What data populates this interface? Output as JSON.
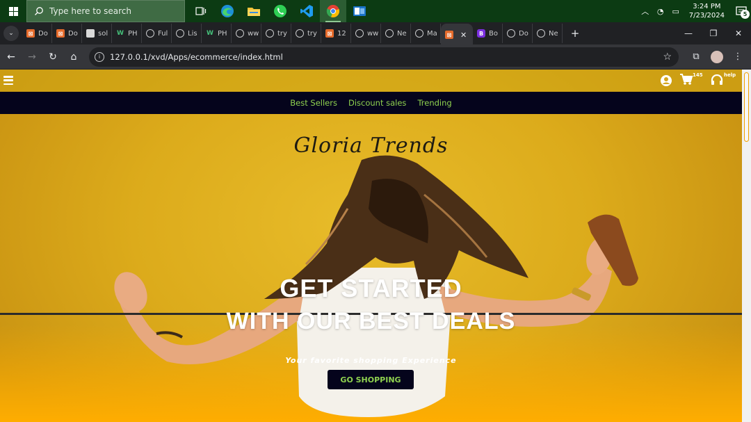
{
  "taskbar": {
    "search_placeholder": "Type here to search",
    "clock_time": "3:24 PM",
    "clock_date": "7/23/2024",
    "notification_count": "5"
  },
  "tabs": [
    {
      "label": "Do",
      "fav": "xampp"
    },
    {
      "label": "Do",
      "fav": "xampp"
    },
    {
      "label": "sol",
      "fav": "profile"
    },
    {
      "label": "PH",
      "fav": "w3"
    },
    {
      "label": "Ful",
      "fav": "globe"
    },
    {
      "label": "Lis",
      "fav": "globe"
    },
    {
      "label": "PH",
      "fav": "w3"
    },
    {
      "label": "ww",
      "fav": "globe"
    },
    {
      "label": "try",
      "fav": "globe"
    },
    {
      "label": "try",
      "fav": "globe"
    },
    {
      "label": "12",
      "fav": "xampp"
    },
    {
      "label": "ww",
      "fav": "globe"
    },
    {
      "label": "Ne",
      "fav": "globe"
    },
    {
      "label": "Ma",
      "fav": "globe"
    },
    {
      "label": "",
      "fav": "xampp",
      "active": true
    },
    {
      "label": "Bo",
      "fav": "bootstrap"
    },
    {
      "label": "Do",
      "fav": "globe"
    },
    {
      "label": "Ne",
      "fav": "globe"
    }
  ],
  "browser": {
    "url": "127.0.0.1/xvd/Apps/ecommerce/index.html"
  },
  "site": {
    "cart_count": "145",
    "help_label": "help",
    "nav": [
      "Best Sellers",
      "Discount sales",
      "Trending"
    ],
    "brand": "Gloria Trends",
    "headline_1": "GET STARTED",
    "headline_2": "WITH OUR BEST DEALS",
    "tagline": "Your favorite shopping Experience",
    "cta_label": "GO SHOPPING"
  },
  "colors": {
    "hero_yellow": "#e7b417",
    "nav_bg": "#05041c",
    "nav_link": "#8fd14f"
  }
}
